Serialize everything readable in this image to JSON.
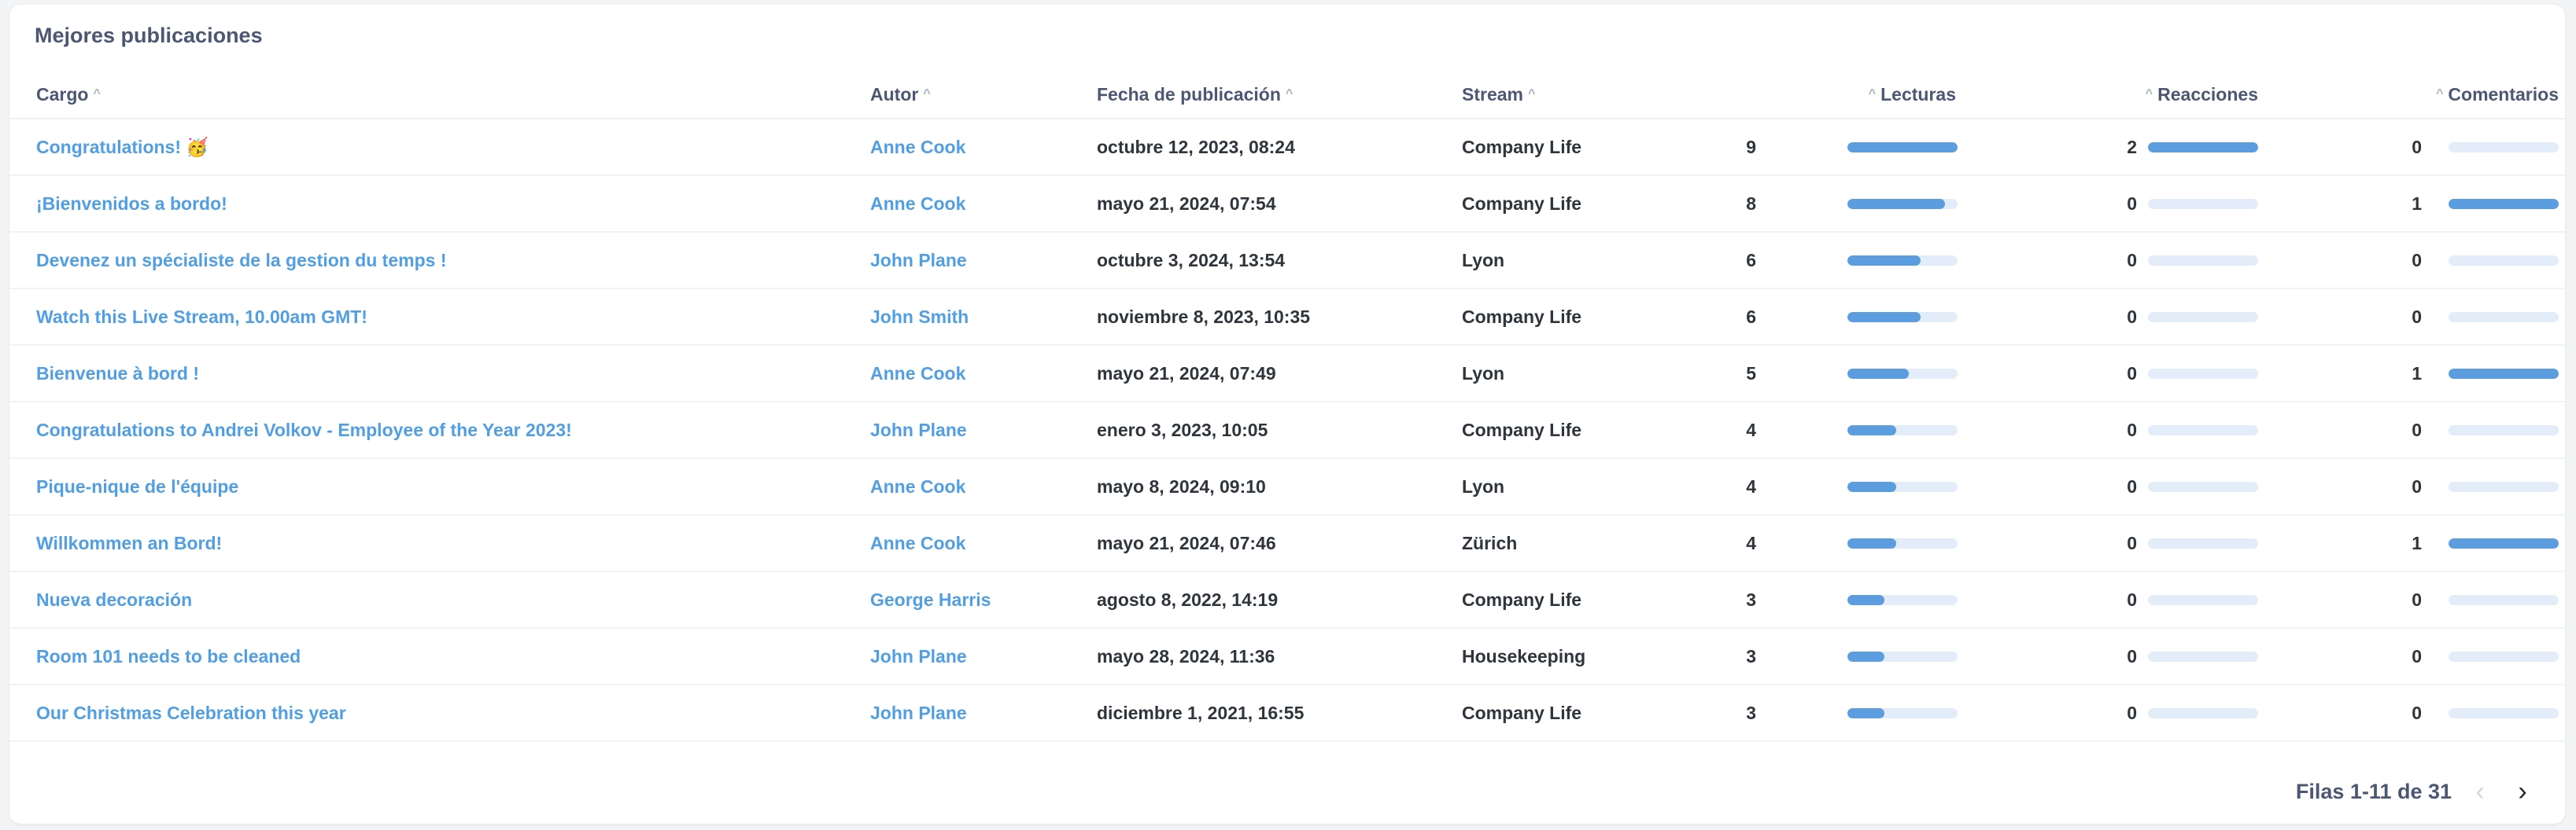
{
  "card": {
    "title": "Mejores publicaciones"
  },
  "columns": {
    "cargo": "Cargo",
    "autor": "Autor",
    "fecha": "Fecha de publicación",
    "stream": "Stream",
    "lecturas": "Lecturas",
    "reacciones": "Reacciones",
    "comentarios": "Comentarios"
  },
  "maxima": {
    "lecturas": 9,
    "reacciones": 2,
    "comentarios": 1
  },
  "rows": [
    {
      "cargo": "Congratulations! 🥳",
      "autor": "Anne Cook",
      "fecha": "octubre 12, 2023, 08:24",
      "stream": "Company Life",
      "lecturas": 9,
      "reacciones": 2,
      "comentarios": 0
    },
    {
      "cargo": "¡Bienvenidos a bordo!",
      "autor": "Anne Cook",
      "fecha": "mayo 21, 2024, 07:54",
      "stream": "Company Life",
      "lecturas": 8,
      "reacciones": 0,
      "comentarios": 1
    },
    {
      "cargo": "Devenez un spécialiste de la gestion du temps !",
      "autor": "John Plane",
      "fecha": "octubre 3, 2024, 13:54",
      "stream": "Lyon",
      "lecturas": 6,
      "reacciones": 0,
      "comentarios": 0
    },
    {
      "cargo": "Watch this Live Stream, 10.00am GMT!",
      "autor": "John Smith",
      "fecha": "noviembre 8, 2023, 10:35",
      "stream": "Company Life",
      "lecturas": 6,
      "reacciones": 0,
      "comentarios": 0
    },
    {
      "cargo": "Bienvenue à bord !",
      "autor": "Anne Cook",
      "fecha": "mayo 21, 2024, 07:49",
      "stream": "Lyon",
      "lecturas": 5,
      "reacciones": 0,
      "comentarios": 1
    },
    {
      "cargo": "Congratulations to Andrei Volkov - Employee of the Year 2023!",
      "autor": "John Plane",
      "fecha": "enero 3, 2023, 10:05",
      "stream": "Company Life",
      "lecturas": 4,
      "reacciones": 0,
      "comentarios": 0
    },
    {
      "cargo": "Pique-nique de l'équipe",
      "autor": "Anne Cook",
      "fecha": "mayo 8, 2024, 09:10",
      "stream": "Lyon",
      "lecturas": 4,
      "reacciones": 0,
      "comentarios": 0
    },
    {
      "cargo": "Willkommen an Bord!",
      "autor": "Anne Cook",
      "fecha": "mayo 21, 2024, 07:46",
      "stream": "Zürich",
      "lecturas": 4,
      "reacciones": 0,
      "comentarios": 1
    },
    {
      "cargo": "Nueva decoración",
      "autor": "George Harris",
      "fecha": "agosto 8, 2022, 14:19",
      "stream": "Company Life",
      "lecturas": 3,
      "reacciones": 0,
      "comentarios": 0
    },
    {
      "cargo": "Room 101 needs to be cleaned",
      "autor": "John Plane",
      "fecha": "mayo 28, 2024, 11:36",
      "stream": "Housekeeping",
      "lecturas": 3,
      "reacciones": 0,
      "comentarios": 0
    },
    {
      "cargo": "Our Christmas Celebration this year",
      "autor": "John Plane",
      "fecha": "diciembre 1, 2021, 16:55",
      "stream": "Company Life",
      "lecturas": 3,
      "reacciones": 0,
      "comentarios": 0
    }
  ],
  "pagination": {
    "label": "Filas 1-11 de 31"
  },
  "icons": {
    "sort": "sort-ascending-icon",
    "prev": "chevron-left-icon",
    "next": "chevron-right-icon"
  },
  "colors": {
    "link": "#509ee3",
    "bar_fill": "#5b9ddf",
    "bar_track": "#e3edf9"
  }
}
